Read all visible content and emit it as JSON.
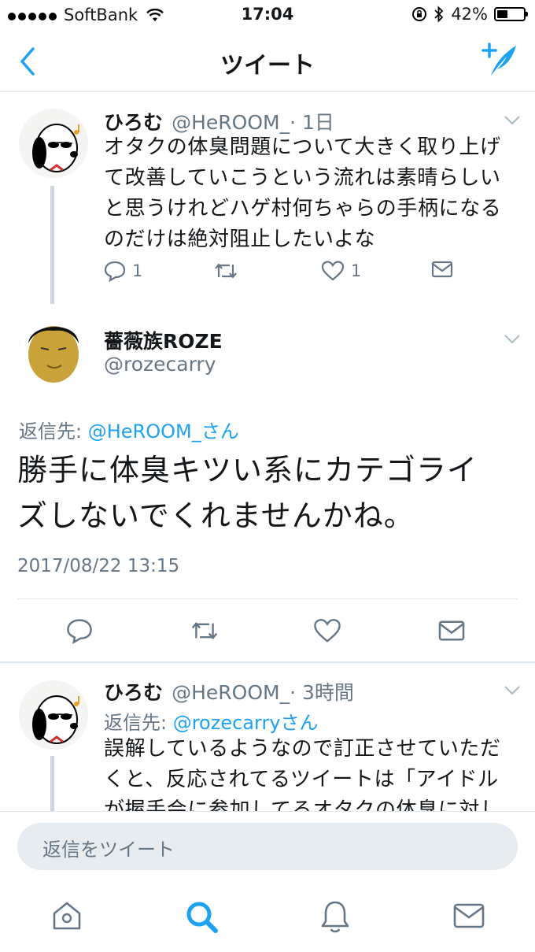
{
  "status_bar": {
    "carrier": "SoftBank",
    "time": "17:04",
    "battery_percent": "42%",
    "battery_level": 0.42
  },
  "nav": {
    "title": "ツイート",
    "back_icon": "chevron-left-icon",
    "compose_icon": "compose-tweet-icon"
  },
  "tweets": [
    {
      "name": "ひろむ",
      "handle": "@HeROOM_",
      "time": "· 1日",
      "text_lines": [
        "オタクの体臭問題について大きく取り上げ",
        "て改善していこうという流れは素晴らしい",
        "と思うけれどハゲ村何ちゃらの手柄になる",
        "のだけは絶対阻止したいよな"
      ],
      "reply_count": "1",
      "like_count": "1"
    },
    {
      "name": "薔薇族ROZE",
      "handle": "@rozecarry",
      "reply_to_label": "返信先: ",
      "reply_to_mention": "@HeROOM_さん",
      "text_lines": [
        "勝手に体臭キツい系にカテゴライ",
        "ズしないでくれませんかね。"
      ],
      "timestamp": "2017/08/22 13:15"
    },
    {
      "name": "ひろむ",
      "handle": "@HeROOM_",
      "time": "· 3時間",
      "reply_to_label": "返信先: ",
      "reply_to_mention": "@rozecarryさん",
      "text_lines": [
        "誤解しているようなので訂正させていただ",
        "くと、反応されてるツイートは「アイドル",
        "が握手会に参加してるオタクの体臭に対し"
      ]
    }
  ],
  "reply_bar": {
    "placeholder": "返信をツイート"
  },
  "tab_bar": {
    "icons": [
      "home-icon",
      "search-icon",
      "notifications-icon",
      "messages-icon"
    ],
    "active": "search-icon"
  },
  "colors": {
    "accent": "#1da1f2",
    "secondary_text": "#657786",
    "divider": "#e1e8ed"
  }
}
